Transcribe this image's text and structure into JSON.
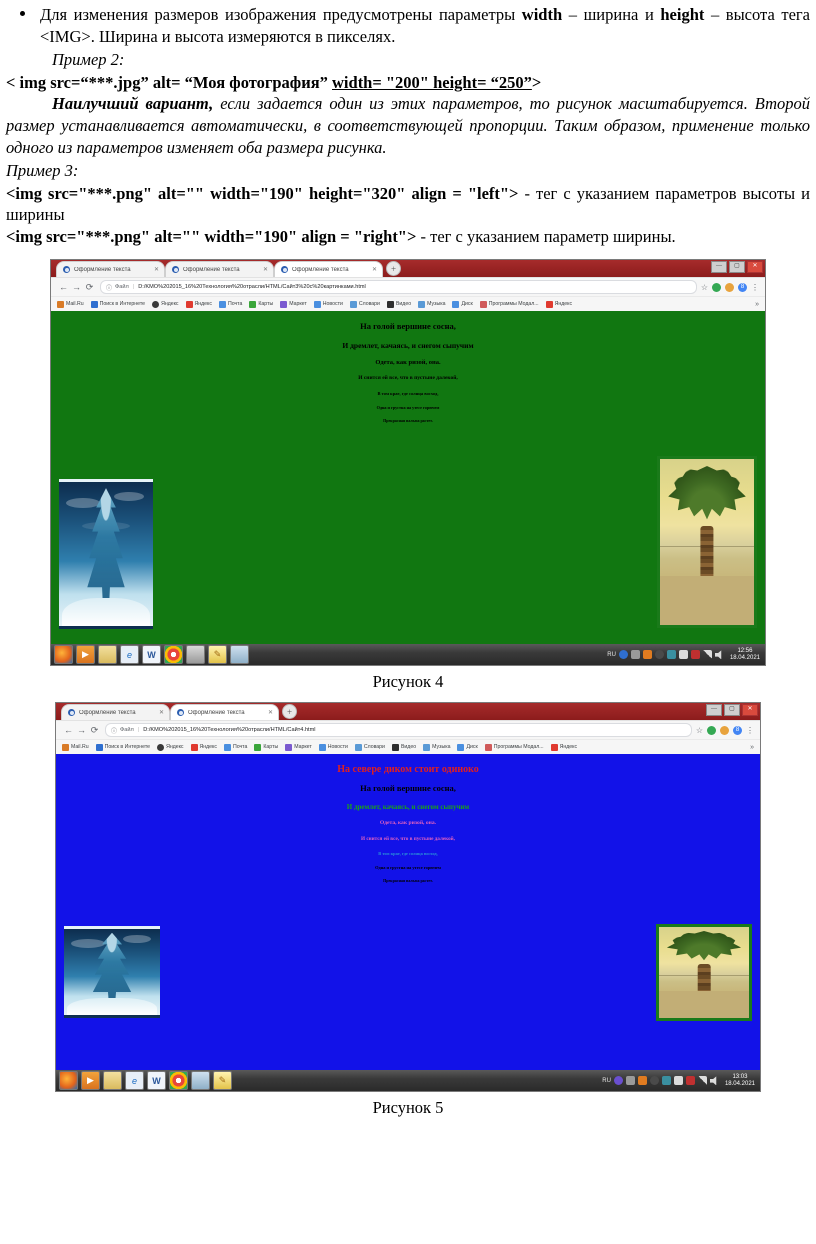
{
  "document": {
    "paragraphs": [
      {
        "id": "p1",
        "style": "bullet",
        "runs": [
          {
            "t": "Для изменения размеров изображения предусмотрены параметры ",
            "f": "normal"
          },
          {
            "t": "width",
            "f": "bold"
          },
          {
            "t": " – ширина и  ",
            "f": "normal"
          },
          {
            "t": "height",
            "f": "bold"
          },
          {
            "t": " – высота тега <IMG>. Ширина и высота измеряются в пикселях.",
            "f": "normal"
          }
        ]
      },
      {
        "id": "p2",
        "style": "indent",
        "runs": [
          {
            "t": "Пример 2:",
            "f": "italic"
          }
        ]
      },
      {
        "id": "p3",
        "style": "code",
        "runs": [
          {
            "t": "< img src=“***.jpg” alt= “Моя фотография” ",
            "f": "bold"
          },
          {
            "t": "width= \"200\" height= “250”",
            "f": "bold-underline"
          },
          {
            "t": ">",
            "f": "bold"
          }
        ]
      },
      {
        "id": "p4",
        "style": "justify",
        "runs": [
          {
            "t": "Наилучший вариант,",
            "f": "bold-italic"
          },
          {
            "t": " если задается один из этих параметров, то рисунок масштабируется. Второй размер устанавливается автоматически, в соответствующей пропорции. Таким образом, применение только одного из параметров изменяет оба размера рисунка.",
            "f": "italic"
          }
        ]
      },
      {
        "id": "p5",
        "style": "plain",
        "runs": [
          {
            "t": "Пример 3:",
            "f": "italic"
          }
        ]
      },
      {
        "id": "p6",
        "style": "code",
        "runs": [
          {
            "t": "<img src=\"***.png\" alt=\"\" width=\"190\" height=\"320\" align = \"left\">",
            "f": "bold"
          },
          {
            "t": " - тег с указанием параметров высоты и ширины",
            "f": "normal"
          }
        ]
      },
      {
        "id": "p7",
        "style": "code",
        "runs": [
          {
            "t": "<img src=\"***.png\" alt=\"\" width=\"190\" align = \"right\">",
            "f": "bold"
          },
          {
            "t": " - тег с указанием параметр ширины.",
            "f": "normal"
          }
        ]
      }
    ]
  },
  "figure4": {
    "caption": "Рисунок 4",
    "browser": {
      "tabs": [
        {
          "title": "Оформление текста",
          "close": "✕"
        },
        {
          "title": "Оформление текста",
          "close": "✕"
        },
        {
          "title": "Оформление текста",
          "close": "✕"
        }
      ],
      "new_tab_label": "+",
      "window_buttons": {
        "minimize": "—",
        "maximize": "▢",
        "close": "✕"
      },
      "nav": {
        "back": "←",
        "forward": "→",
        "reload": "⟳",
        "scheme_icon": "ⓘ",
        "scheme_label": "Файл",
        "separator": "|",
        "url": "D:/KMO%202015_16%20Технология%20отрасли/HTML/Сайт3%20с%20картинками.html",
        "bookmark_star": "☆",
        "profile_letter": "8",
        "menu": "⋮"
      },
      "bookmarks": [
        {
          "label": "Mail.Ru",
          "color": "#d97b27"
        },
        {
          "label": "Поиск в Интернете",
          "color": "#2f6fd0"
        },
        {
          "label": "Яндекс",
          "color": "#3a3a3a"
        },
        {
          "label": "Яндекс",
          "color": "#e03a2f"
        },
        {
          "label": "Почта",
          "color": "#4a8fe0"
        },
        {
          "label": "Карты",
          "color": "#3aa63a"
        },
        {
          "label": "Маркет",
          "color": "#7b5ad0"
        },
        {
          "label": "Новости",
          "color": "#4a8fe0"
        },
        {
          "label": "Словари",
          "color": "#5a9ad6"
        },
        {
          "label": "Видео",
          "color": "#2e2e2e"
        },
        {
          "label": "Музыка",
          "color": "#5a9ad6"
        },
        {
          "label": "Диск",
          "color": "#4a8fe0"
        },
        {
          "label": "Программы Модал...",
          "color": "#d05a5a"
        },
        {
          "label": "Яндекс",
          "color": "#e03a2f"
        }
      ],
      "bookmarks_overflow": "»"
    },
    "page": {
      "background_color": "#117711",
      "lines": [
        {
          "text": "На голой вершине сосна,",
          "color": "#000000",
          "size": 8.5
        },
        {
          "text": "И дремлет, качаясь, и снегом сыпучим",
          "color": "#000000",
          "size": 7.5
        },
        {
          "text": "Одета, как ризой, она.",
          "color": "#000000",
          "size": 6.5
        },
        {
          "text": "И снится ей все, что в пустыне далекой,",
          "color": "#000000",
          "size": 5.5
        },
        {
          "text": "В том крае, где солнца восход,",
          "color": "#000000",
          "size": 4.5
        },
        {
          "text": "Одна и грустна на утесе горючем",
          "color": "#000000",
          "size": 4.2
        },
        {
          "text": "Прекрасная пальма растет.",
          "color": "#000000",
          "size": 4.0
        }
      ],
      "image_left_alt": "Заснеженная сосна",
      "image_right_alt": "Пальма в пустыне"
    },
    "taskbar": {
      "icons": [
        "firefox-icon",
        "media-player-icon",
        "explorer-icon",
        "internet-explorer-icon",
        "word-icon",
        "chrome-icon",
        "opera-icon",
        "notepad-icon"
      ],
      "language": "RU",
      "time": "12:56",
      "date": "18.04.2021"
    }
  },
  "figure5": {
    "caption": "Рисунок 5",
    "browser": {
      "tabs": [
        {
          "title": "Оформление текста",
          "close": "✕"
        },
        {
          "title": "Оформление текста",
          "close": "✕"
        }
      ],
      "new_tab_label": "+",
      "window_buttons": {
        "minimize": "—",
        "maximize": "▢",
        "close": "✕"
      },
      "nav": {
        "back": "←",
        "forward": "→",
        "reload": "⟳",
        "scheme_icon": "ⓘ",
        "scheme_label": "Файл",
        "separator": "|",
        "url": "D:/KMO%202015_16%20Технология%20отрасли/HTML/Сайт4.html",
        "bookmark_star": "☆",
        "profile_letter": "8",
        "menu": "⋮"
      },
      "bookmarks": [
        {
          "label": "Mail.Ru",
          "color": "#d97b27"
        },
        {
          "label": "Поиск в Интернете",
          "color": "#2f6fd0"
        },
        {
          "label": "Яндекс",
          "color": "#3a3a3a"
        },
        {
          "label": "Яндекс",
          "color": "#e03a2f"
        },
        {
          "label": "Почта",
          "color": "#4a8fe0"
        },
        {
          "label": "Карты",
          "color": "#3aa63a"
        },
        {
          "label": "Маркет",
          "color": "#7b5ad0"
        },
        {
          "label": "Новости",
          "color": "#4a8fe0"
        },
        {
          "label": "Словари",
          "color": "#5a9ad6"
        },
        {
          "label": "Видео",
          "color": "#2e2e2e"
        },
        {
          "label": "Музыка",
          "color": "#5a9ad6"
        },
        {
          "label": "Диск",
          "color": "#4a8fe0"
        },
        {
          "label": "Программы Модал...",
          "color": "#d05a5a"
        },
        {
          "label": "Яндекс",
          "color": "#e03a2f"
        }
      ],
      "bookmarks_overflow": "»"
    },
    "page": {
      "background_color": "#1212e8",
      "heading": {
        "text": "На севере диком стоит одиноко",
        "color": "#e02020",
        "size": 10
      },
      "lines": [
        {
          "text": "На голой вершине сосна,",
          "color": "#000000",
          "size": 8.5
        },
        {
          "text": "И дремлет, качаясь, и снегом сыпучим",
          "color": "#1aa11a",
          "size": 7.0
        },
        {
          "text": "Одета, как ризой, она.",
          "color": "#e060c0",
          "size": 5.6
        },
        {
          "text": "И снится ей все, что в пустыне далекой,",
          "color": "#e060c0",
          "size": 5.2
        },
        {
          "text": "В том крае, где солнца восход,",
          "color": "#2a8fd8",
          "size": 4.4
        },
        {
          "text": "Одна и грустна на утесе горючем",
          "color": "#000000",
          "size": 4.4
        },
        {
          "text": "Прекрасная пальма растет.",
          "color": "#000000",
          "size": 4.0
        }
      ],
      "image_left_alt": "Заснеженная сосна",
      "image_right_alt": "Пальма в пустыне"
    },
    "taskbar": {
      "icons": [
        "firefox-icon",
        "media-player-icon",
        "explorer-icon",
        "internet-explorer-icon",
        "word-icon",
        "chrome-icon",
        "notepad-icon",
        "opera-icon"
      ],
      "language": "RU",
      "time": "13:03",
      "date": "18.04.2021"
    }
  }
}
